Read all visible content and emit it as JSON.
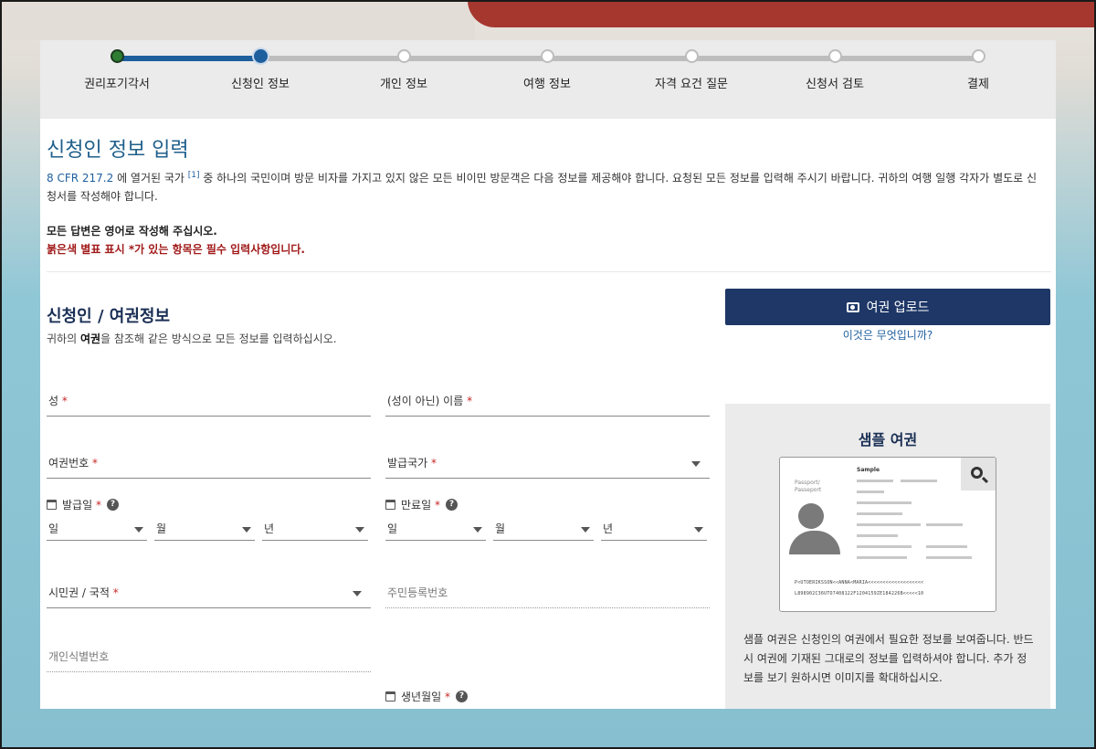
{
  "progress": {
    "steps": [
      {
        "label": "권리포기각서",
        "state": "done"
      },
      {
        "label": "신청인 정보",
        "state": "current"
      },
      {
        "label": "개인 정보",
        "state": "todo"
      },
      {
        "label": "여행 정보",
        "state": "todo"
      },
      {
        "label": "자격 요건 질문",
        "state": "todo"
      },
      {
        "label": "신청서 검토",
        "state": "todo"
      },
      {
        "label": "결제",
        "state": "todo"
      }
    ]
  },
  "header": {
    "title": "신청인 정보 입력",
    "cfr_link": "8 CFR 217.2",
    "intro_before": " 에 열거된 국가 ",
    "footnote": "[1]",
    "intro_after": " 중 하나의 국민이며 방문 비자를 가지고 있지 않은 모든 비이민 방문객은 다음 정보를 제공해야 합니다. 요청된 모든 정보를 입력해 주시기 바랍니다. 귀하의 여행 일행 각자가 별도로 신청서를 작성해야 합니다.",
    "note_english": "모든 답변은 영어로 작성해 주십시오.",
    "note_required": "붉은색 별표 표시 *가 있는 항목은 필수 입력사항입니다."
  },
  "section": {
    "title": "신청인 / 여권정보",
    "sub_before": "귀하의 ",
    "sub_bold": "여권",
    "sub_after": "을 참조해 같은 방식으로 모든 정보를 입력하십시오."
  },
  "upload": {
    "label": "여권 업로드",
    "what_is_this": "이것은 무엇입니까?"
  },
  "fields": {
    "surname": "성",
    "given_name": "(성이 아닌) 이름",
    "passport_number": "여권번호",
    "issuing_country": "발급국가",
    "issue_date": "발급일",
    "expiry_date": "만료일",
    "citizenship": "시민권 / 국적",
    "national_id": "주민등록번호",
    "personal_id": "개인식별번호",
    "birth_date": "생년월일",
    "required_mark": "*",
    "help_mark": "?",
    "day": "일",
    "month": "월",
    "year": "년"
  },
  "sample": {
    "title": "샘플 여권",
    "image_caption": "Sample",
    "passport_word_1": "Passport/",
    "passport_word_2": "Passeport",
    "mrz_1": "P<UTOERIKSSON<<ANNA<MARIA<<<<<<<<<<<<<<<<<<<",
    "mrz_2": "L898902C36UTO7408122F1204159ZE184226B<<<<<10",
    "description": "샘플 여권은 신청인의 여권에서 필요한 정보를 보여줍니다. 반드시 여권에 기재된 그대로의 정보를 입력하셔야 합니다. 추가 정보를 보기 원하시면 이미지를 확대하십시오."
  }
}
